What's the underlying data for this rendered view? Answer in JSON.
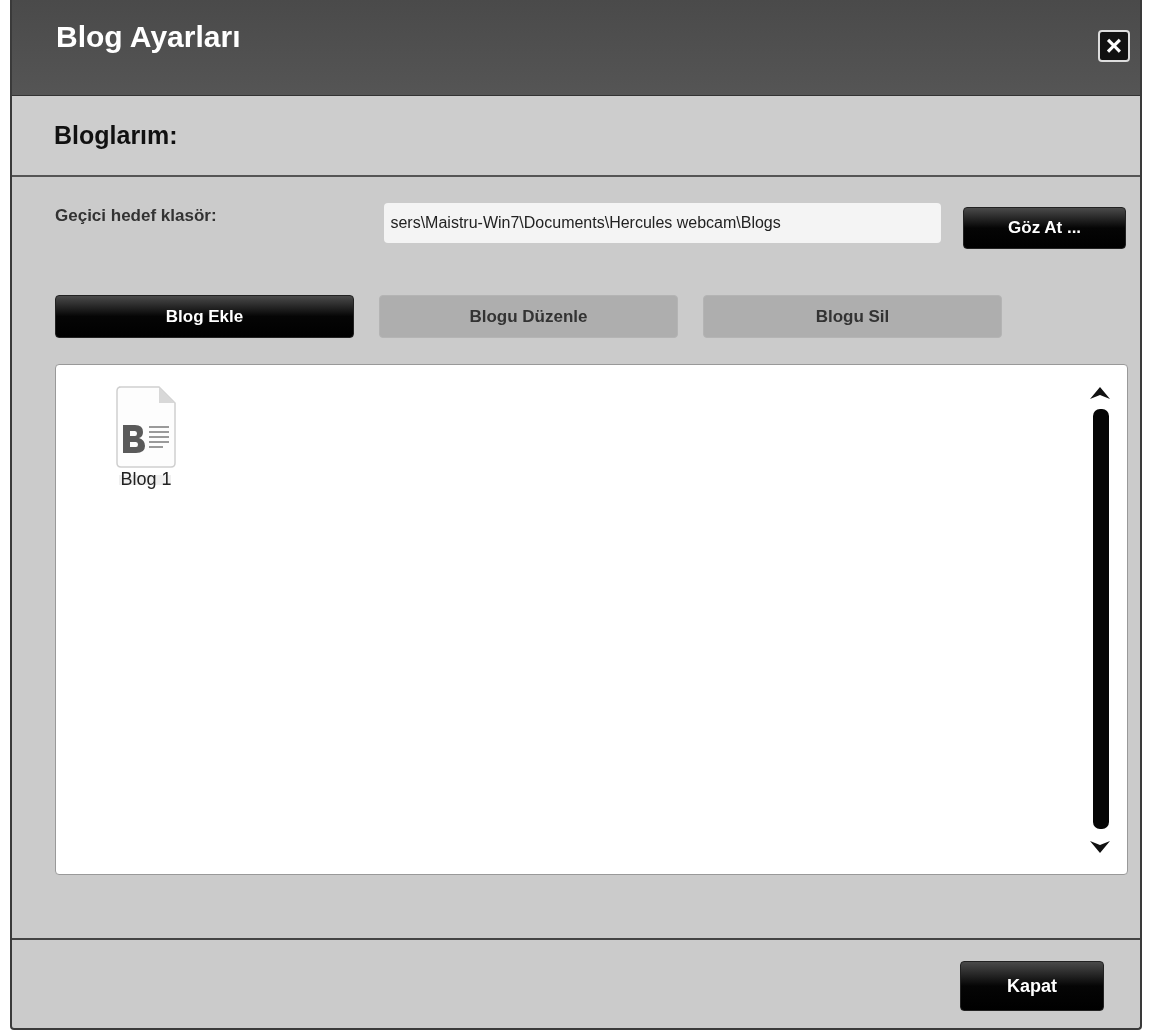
{
  "window": {
    "title": "Blog Ayarları",
    "close": "×"
  },
  "section": {
    "title": "Bloglarım:"
  },
  "folder": {
    "label": "Geçici hedef klasör:",
    "value": "sers\\Maistru-Win7\\Documents\\Hercules webcam\\Blogs",
    "browse": "Göz At ..."
  },
  "actions": [
    {
      "label": "Blog Ekle",
      "disabled": false
    },
    {
      "label": "Blogu Düzenle",
      "disabled": true
    },
    {
      "label": "Blogu Sil",
      "disabled": true
    }
  ],
  "blogs": [
    {
      "name": "Blog 1",
      "selected": false
    }
  ],
  "footer": {
    "button": "Kapat"
  }
}
